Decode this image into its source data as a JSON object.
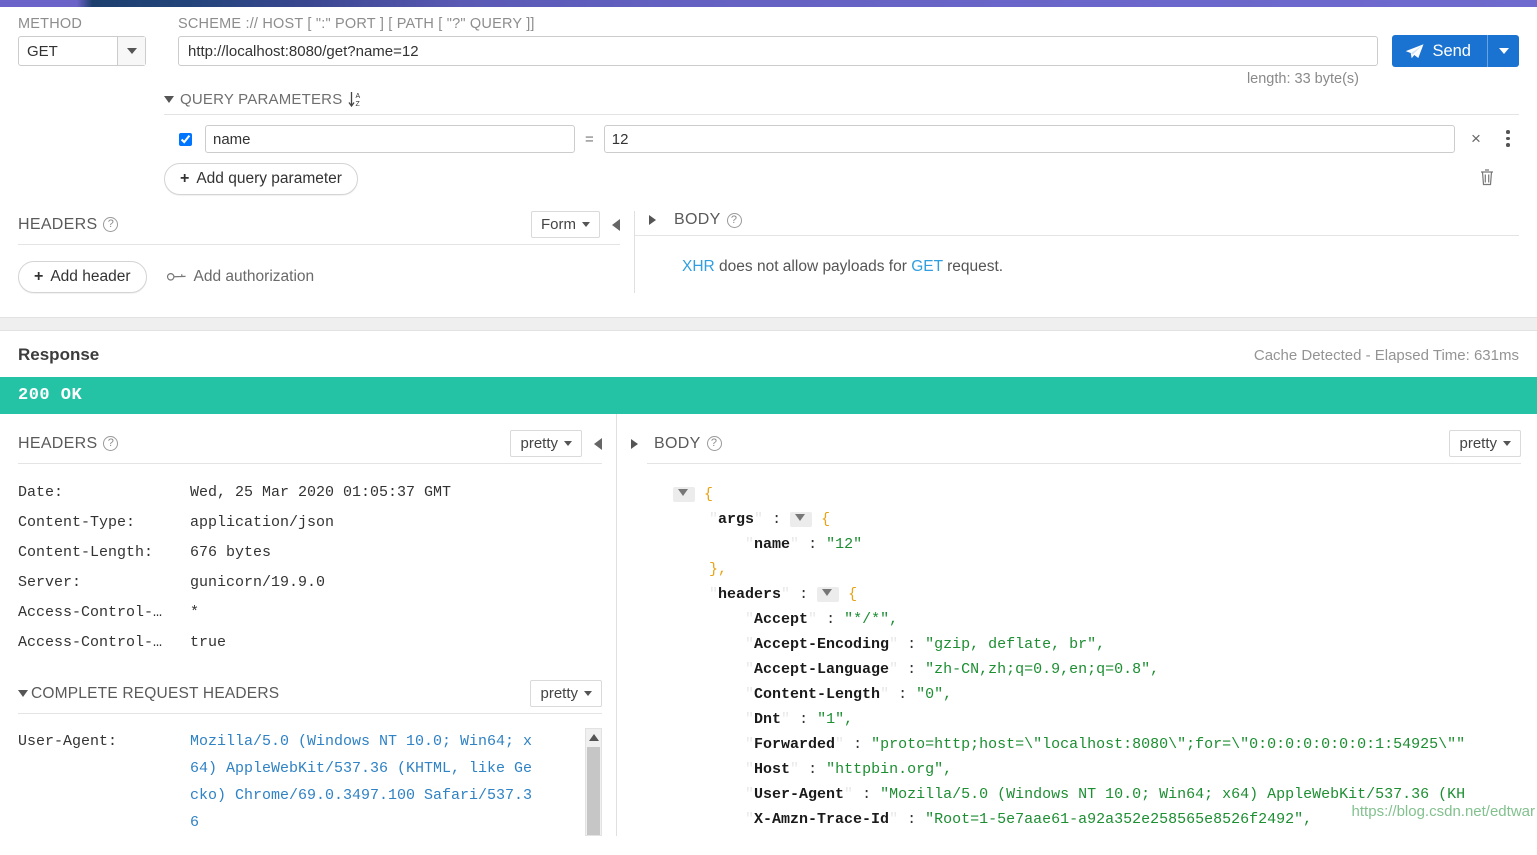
{
  "request": {
    "labels": {
      "method": "METHOD",
      "url": "SCHEME :// HOST [ \":\" PORT ] [ PATH [ \"?\" QUERY ]]"
    },
    "method_value": "GET",
    "url_value": "http://localhost:8080/get?name=12",
    "send_label": "Send",
    "length_text": "length: 33 byte(s)",
    "query_parameters": {
      "title": "QUERY PARAMETERS",
      "rows": [
        {
          "enabled": true,
          "key": "name",
          "eq": "=",
          "value": "12",
          "remove": "×"
        }
      ],
      "add_label": "Add query parameter"
    },
    "headers_panel": {
      "title": "HEADERS",
      "help": "?",
      "format": "Form",
      "add_header_label": "Add header",
      "add_authorization_label": "Add authorization"
    },
    "body_panel": {
      "title": "BODY",
      "help": "?",
      "note_prefix": "XHR",
      "note_middle": " does not allow payloads for ",
      "note_method": "GET",
      "note_suffix": " request."
    }
  },
  "response": {
    "title": "Response",
    "meta": "Cache Detected - Elapsed Time: 631ms",
    "status": "200 OK",
    "status_color": "#25c3a5",
    "headers_panel": {
      "title": "HEADERS",
      "help": "?",
      "format": "pretty",
      "rows": [
        {
          "key": "Date:",
          "value": "Wed, 25 Mar 2020 01:05:37 GMT"
        },
        {
          "key": "Content-Type:",
          "value": "application/json"
        },
        {
          "key": "Content-Length:",
          "value": "676 bytes"
        },
        {
          "key": "Server:",
          "value": "gunicorn/19.9.0"
        },
        {
          "key": "Access-Control-…",
          "value": "*"
        },
        {
          "key": "Access-Control-…",
          "value": "true"
        }
      ]
    },
    "complete_request_headers": {
      "title": "COMPLETE REQUEST HEADERS",
      "format": "pretty",
      "rows": [
        {
          "key": "User-Agent:",
          "value_lines": [
            "Mozilla/5.0 (Windows NT 10.0; Win64; x",
            "64) AppleWebKit/537.36 (KHTML, like Ge",
            "cko) Chrome/69.0.3497.100 Safari/537.3",
            "6"
          ]
        }
      ]
    },
    "body_panel": {
      "title": "BODY",
      "help": "?",
      "format": "pretty",
      "json_lines": [
        {
          "indent": 0,
          "toggle": "down",
          "text": "{",
          "kind": "brace"
        },
        {
          "indent": 1,
          "key": "args",
          "colon": ":",
          "toggle": "down",
          "text": "{",
          "kind": "obj-open"
        },
        {
          "indent": 2,
          "key": "name",
          "colon": ":",
          "value": "\"12\"",
          "kind": "pair"
        },
        {
          "indent": 1,
          "text": "},",
          "kind": "brace"
        },
        {
          "indent": 1,
          "key": "headers",
          "colon": ":",
          "toggle": "down",
          "text": "{",
          "kind": "obj-open"
        },
        {
          "indent": 2,
          "key": "Accept",
          "colon": ":",
          "value": "\"*/*\",",
          "kind": "pair"
        },
        {
          "indent": 2,
          "key": "Accept-Encoding",
          "colon": ":",
          "value": "\"gzip, deflate, br\",",
          "kind": "pair"
        },
        {
          "indent": 2,
          "key": "Accept-Language",
          "colon": ":",
          "value": "\"zh-CN,zh;q=0.9,en;q=0.8\",",
          "kind": "pair"
        },
        {
          "indent": 2,
          "key": "Content-Length",
          "colon": ":",
          "value": "\"0\",",
          "kind": "pair"
        },
        {
          "indent": 2,
          "key": "Dnt",
          "colon": ":",
          "value": "\"1\",",
          "kind": "pair"
        },
        {
          "indent": 2,
          "key": "Forwarded",
          "colon": ":",
          "value": "\"proto=http;host=\\\"localhost:8080\\\";for=\\\"0:0:0:0:0:0:0:1:54925\\\"\"",
          "kind": "pair"
        },
        {
          "indent": 2,
          "key": "Host",
          "colon": ":",
          "value": "\"httpbin.org\",",
          "kind": "pair"
        },
        {
          "indent": 2,
          "key": "User-Agent",
          "colon": ":",
          "value": "\"Mozilla/5.0 (Windows NT 10.0; Win64; x64) AppleWebKit/537.36 (KH",
          "kind": "pair"
        },
        {
          "indent": 2,
          "key": "X-Amzn-Trace-Id",
          "colon": ":",
          "value": "\"Root=1-5e7aae61-a92a352e258565e8526f2492\",",
          "kind": "pair"
        }
      ]
    },
    "watermark": "https://blog.csdn.net/edtwar"
  }
}
